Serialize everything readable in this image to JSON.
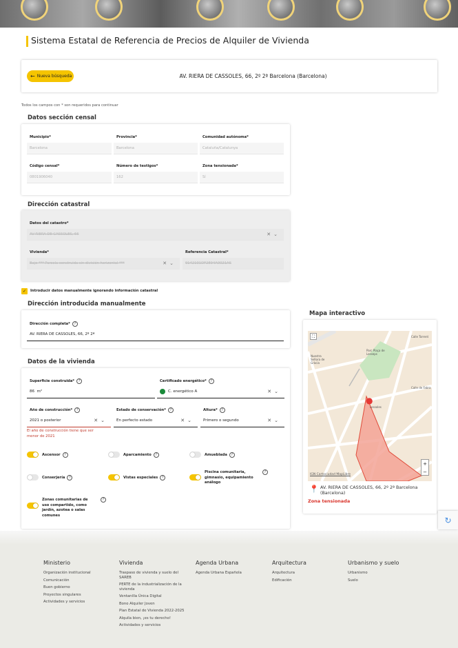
{
  "page_title": "Sistema Estatal de Referencia de Precios de Alquiler de Vivienda",
  "search": {
    "new_search_label": "Nueva búsqueda",
    "address": "AV. RIERA DE CASSOLES, 66, 2º 2ª Barcelona (Barcelona)"
  },
  "required_note": "Todos los campos con * son requeridos para continuar",
  "census": {
    "title": "Datos sección censal",
    "municipio_label": "Municipio*",
    "municipio_value": "Barcelona",
    "provincia_label": "Provincia*",
    "provincia_value": "Barcelona",
    "comunidad_label": "Comunidad autónoma*",
    "comunidad_value": "Cataluña/Catalunya",
    "codigo_label": "Código censal*",
    "codigo_value": "0801906040",
    "testigos_label": "Número de testigos*",
    "testigos_value": "162",
    "zona_label": "Zona tensionada*",
    "zona_value": "Sí"
  },
  "catastral": {
    "title": "Dirección catastral",
    "catastro_label": "Datos del catastro*",
    "catastro_value": "AV RIERA DE CASSOLES, 66",
    "vivienda_label": "Vivienda*",
    "vivienda_value": "Bajo *** Parcela construida sin división horizontal ***",
    "referencia_label": "Referencia Catastral*",
    "referencia_value": "9142101DF2894A0021AS"
  },
  "manual_checkbox_label": "Introducir datos manualmente ignorando información catastral",
  "manual": {
    "title": "Dirección introducida manualmente",
    "direccion_label": "Dirección completa*",
    "direccion_value": "AV. RIERA DE CASSOLES, 66, 2º 2ª"
  },
  "vivienda": {
    "title": "Datos de la vivienda",
    "superficie_label": "Superficie construida*",
    "superficie_value": "86",
    "superficie_unit": "m²",
    "certificado_label": "Certificado energético*",
    "certificado_value": "C. energético A",
    "certificado_color": "#1a8a3a",
    "anio_label": "Año de construcción*",
    "anio_value": "2021 o posterior",
    "anio_error": "El año de construcción tiene que ser menor de 2021",
    "estado_label": "Estado de conservación*",
    "estado_value": "En perfecto estado",
    "altura_label": "Altura*",
    "altura_value": "Primero o segundo",
    "toggles": {
      "ascensor": {
        "label": "Ascensor",
        "on": true
      },
      "aparcamiento": {
        "label": "Aparcamiento",
        "on": false
      },
      "amueblada": {
        "label": "Amueblada",
        "on": false
      },
      "conserjeria": {
        "label": "Conserjería",
        "on": false
      },
      "vistas": {
        "label": "Vistas especiales",
        "on": true
      },
      "piscina": {
        "label": "Piscina comunitaria, gimnasio, equipamiento análogo",
        "on": true
      },
      "zonas": {
        "label": "Zonas comunitarias de uso compartido, como jardín, azotea o salas comunes",
        "on": true
      }
    }
  },
  "map": {
    "title": "Mapa interactivo",
    "address": "AV. RIERA DE CASSOLES, 66, 2º 2ª Barcelona (Barcelona)",
    "zone_label": "Zona tensionada",
    "attribution": "IGN Cartociudad MapLibre",
    "zoom_in": "+",
    "zoom_out": "−",
    "street_labels": [
      "Calle Torrent",
      "Calle Sant Pau",
      "Calle Torrent",
      "Parc Plaça de Lesseps",
      "Nuestra Señora de Gràcia",
      "Calle Sentinat",
      "Calle Sant Elies",
      "Calle Sant Gervasi",
      "Calle Torre",
      "Calle de Fabra",
      "Lessoles"
    ]
  },
  "footer": {
    "columns": [
      {
        "title": "Ministerio",
        "items": [
          "Organización institucional",
          "Comunicación",
          "Buen gobierno",
          "Proyectos singulares",
          "Actividades y servicios"
        ]
      },
      {
        "title": "Vivienda",
        "items": [
          "Traspaso de vivienda y suelo del SAREB",
          "PERTE de la industrialización de la vivienda",
          "Ventanilla Única Digital",
          "Bono Alquiler Joven",
          "Plan Estatal de Vivienda 2022-2025",
          "Alquila bien, ¡es tu derecho!",
          "Actividades y servicios"
        ]
      },
      {
        "title": "Agenda Urbana",
        "items": [
          "Agenda Urbana Española"
        ]
      },
      {
        "title": "Arquitectura",
        "items": [
          "Arquitectura",
          "Edificación"
        ]
      },
      {
        "title": "Urbanismo y suelo",
        "items": [
          "Urbanismo",
          "Suelo"
        ]
      }
    ]
  },
  "colors": {
    "accent": "#f5c400",
    "error": "#c0392b",
    "zone": "#d9342b"
  }
}
